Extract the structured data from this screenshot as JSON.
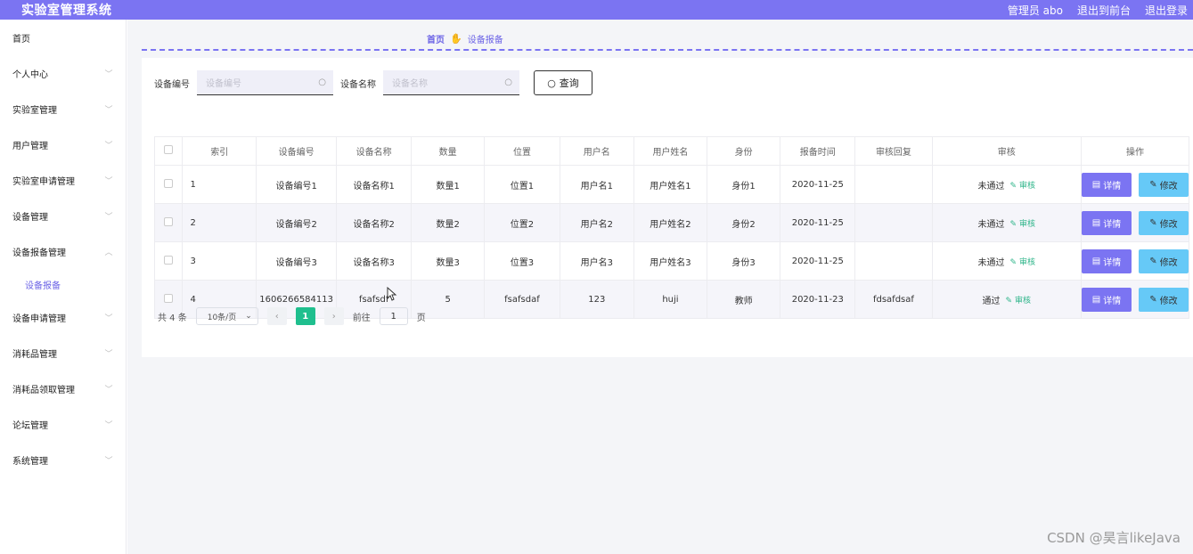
{
  "header": {
    "title": "实验室管理系统",
    "user": "管理员 abo",
    "to_front": "退出到前台",
    "logout": "退出登录"
  },
  "sidebar": {
    "items": [
      {
        "label": "首页",
        "chevron": false
      },
      {
        "label": "个人中心",
        "chevron": true
      },
      {
        "label": "实验室管理",
        "chevron": true
      },
      {
        "label": "用户管理",
        "chevron": true
      },
      {
        "label": "实验室申请管理",
        "chevron": true
      },
      {
        "label": "设备管理",
        "chevron": true
      },
      {
        "label": "设备报备管理",
        "chevron": true,
        "expanded": true
      },
      {
        "label": "设备报备",
        "sub": true
      },
      {
        "label": "设备申请管理",
        "chevron": true
      },
      {
        "label": "消耗品管理",
        "chevron": true
      },
      {
        "label": "消耗品领取管理",
        "chevron": true
      },
      {
        "label": "论坛管理",
        "chevron": true
      },
      {
        "label": "系统管理",
        "chevron": true
      }
    ]
  },
  "breadcrumb": {
    "home": "首页",
    "current": "设备报备"
  },
  "search": {
    "label1": "设备编号",
    "placeholder1": "设备编号",
    "label2": "设备名称",
    "placeholder2": "设备名称",
    "query_button": "查询"
  },
  "table": {
    "headers": [
      "索引",
      "设备编号",
      "设备名称",
      "数量",
      "位置",
      "用户名",
      "用户姓名",
      "身份",
      "报备时间",
      "审核回复",
      "审核",
      "操作"
    ],
    "rows": [
      {
        "index": "1",
        "code": "设备编号1",
        "name": "设备名称1",
        "qty": "数量1",
        "location": "位置1",
        "username": "用户名1",
        "realname": "用户姓名1",
        "role": "身份1",
        "time": "2020-11-25",
        "reply": "",
        "status": "未通过",
        "audit": "审核"
      },
      {
        "index": "2",
        "code": "设备编号2",
        "name": "设备名称2",
        "qty": "数量2",
        "location": "位置2",
        "username": "用户名2",
        "realname": "用户姓名2",
        "role": "身份2",
        "time": "2020-11-25",
        "reply": "",
        "status": "未通过",
        "audit": "审核"
      },
      {
        "index": "3",
        "code": "设备编号3",
        "name": "设备名称3",
        "qty": "数量3",
        "location": "位置3",
        "username": "用户名3",
        "realname": "用户姓名3",
        "role": "身份3",
        "time": "2020-11-25",
        "reply": "",
        "status": "未通过",
        "audit": "审核"
      },
      {
        "index": "4",
        "code": "1606266584113",
        "name": "fsafsdf",
        "qty": "5",
        "location": "fsafsdaf",
        "username": "123",
        "realname": "huji",
        "role": "教师",
        "time": "2020-11-23",
        "reply": "fdsafdsaf",
        "status": "通过",
        "audit": "审核"
      }
    ],
    "detail_label": "详情",
    "edit_label": "修改"
  },
  "pager": {
    "total": "共 4 条",
    "page_size": "10条/页",
    "current_page": "1",
    "goto_label": "前往",
    "goto_value": "1",
    "page_unit": "页"
  },
  "watermark": "CSDN @昊言likeJava",
  "colors": {
    "accent": "#7b74f2",
    "edit_button": "#66c9f7",
    "page_active": "#1fbf8e",
    "audit_link": "#2fb58a"
  }
}
